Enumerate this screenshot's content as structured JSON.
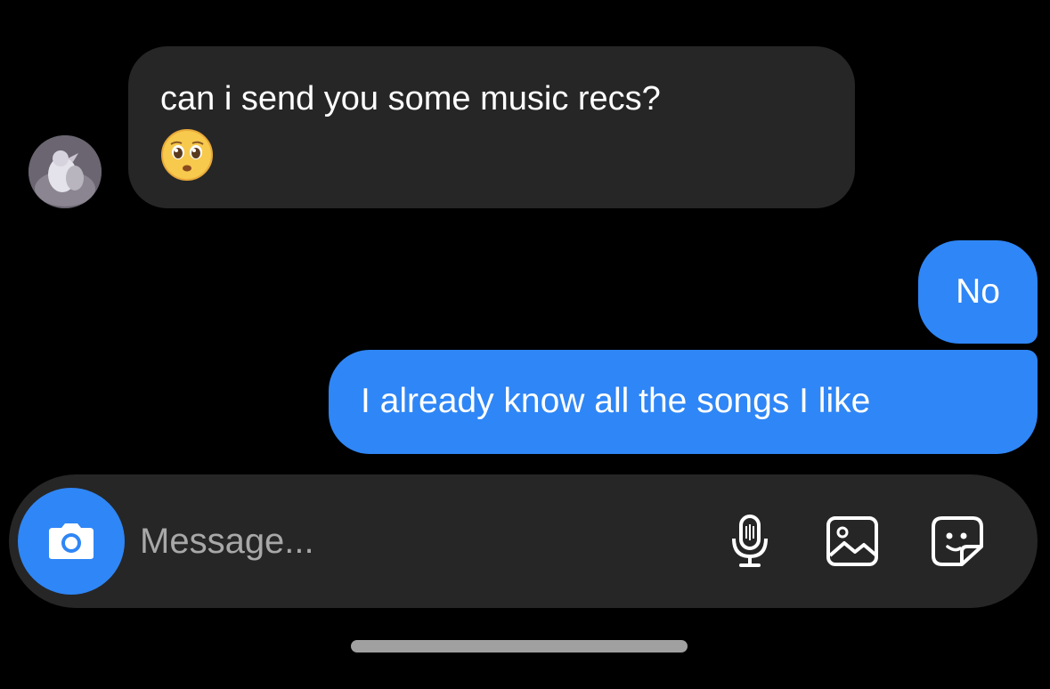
{
  "messages": {
    "incoming": {
      "text": "can i send you some music recs?",
      "emoji": "pleading-face-emoji"
    },
    "outgoing": [
      {
        "text": "No"
      },
      {
        "text": "I already know all the songs I like"
      }
    ]
  },
  "composer": {
    "placeholder": "Message...",
    "icons": [
      "camera-icon",
      "microphone-icon",
      "gallery-icon",
      "sticker-icon"
    ]
  },
  "colors": {
    "background": "#000000",
    "incoming_bubble": "#262626",
    "outgoing_bubble": "#2f86f6",
    "composer": "#262626",
    "accent": "#2f86f6"
  }
}
